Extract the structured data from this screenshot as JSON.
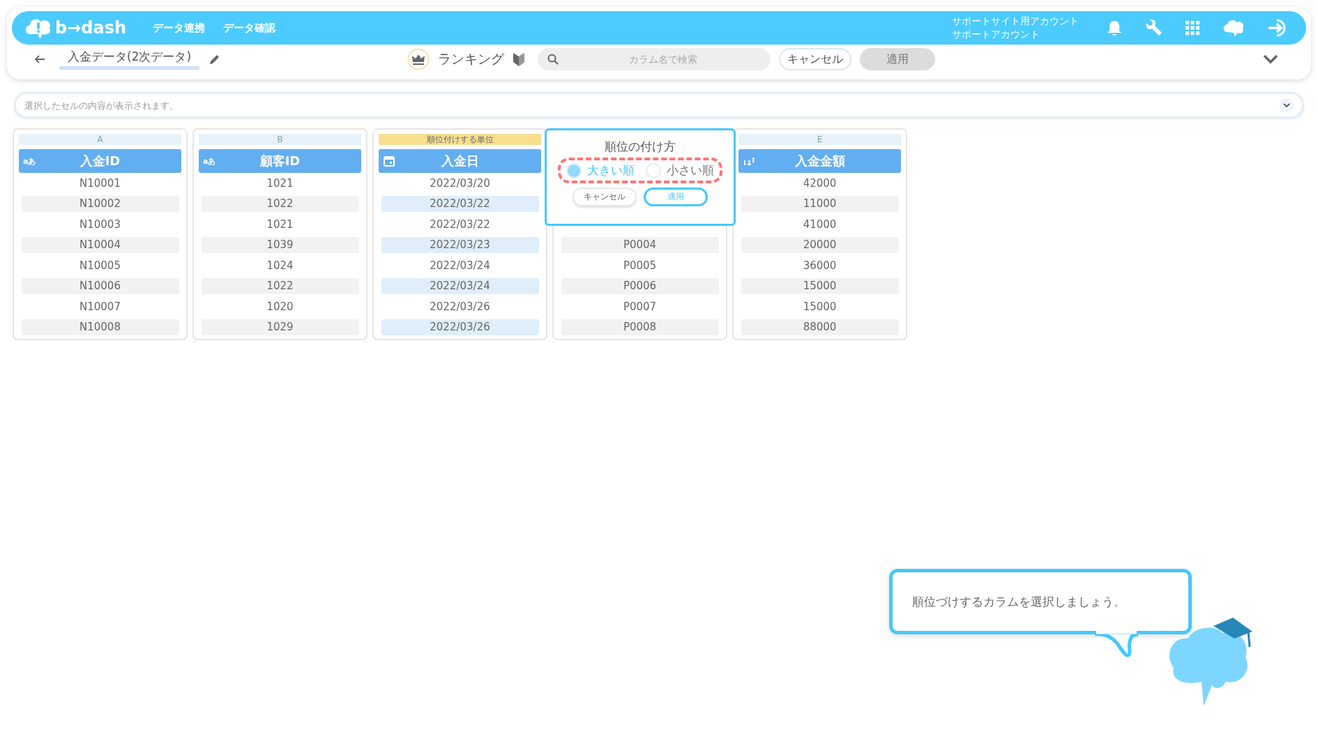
{
  "header": {
    "logo": "b→dash",
    "nav": [
      "データ連携",
      "データ確認"
    ],
    "account": [
      "サポートサイト用アカウント",
      "サポートアカウント"
    ]
  },
  "toolbar": {
    "title": "入金データ(2次データ)",
    "mode": "ランキング",
    "search": {
      "placeholder": "カラム名で検索"
    },
    "cancel": "キャンセル",
    "apply": {
      "label": "適用",
      "disabled": true
    }
  },
  "cell_bar": {
    "placeholder": "選択したセルの内容が表示されます。"
  },
  "columns": [
    {
      "band": "A",
      "unit": false,
      "kind": "text",
      "type_label": "aあ",
      "name": "入金ID",
      "cells": [
        "N10001",
        "N10002",
        "N10003",
        "N10004",
        "N10005",
        "N10006",
        "N10007",
        "N10008"
      ]
    },
    {
      "band": "B",
      "unit": false,
      "kind": "text",
      "type_label": "aあ",
      "name": "顧客ID",
      "cells": [
        "1021",
        "1022",
        "1021",
        "1039",
        "1024",
        "1022",
        "1020",
        "1029"
      ]
    },
    {
      "band": "順位付けする単位",
      "unit": true,
      "kind": "date",
      "name": "入金日",
      "cells": [
        "2022/03/20",
        "2022/03/22",
        "2022/03/22",
        "2022/03/23",
        "2022/03/24",
        "2022/03/24",
        "2022/03/26",
        "2022/03/26"
      ]
    },
    {
      "unit": false,
      "kind": "hidden",
      "cells": [
        "P0004",
        "P0005",
        "P0006",
        "P0007",
        "P0008"
      ]
    },
    {
      "band": "E",
      "unit": false,
      "kind": "number",
      "name": "入金金額",
      "cells": [
        "42000",
        "11000",
        "41000",
        "20000",
        "36000",
        "15000",
        "15000",
        "88000"
      ]
    }
  ],
  "popup": {
    "title": "順位の付け方",
    "options": [
      {
        "label": "大きい順",
        "selected": true
      },
      {
        "label": "小さい順",
        "selected": false
      }
    ],
    "buttons": [
      "キャンセル",
      "適用"
    ]
  },
  "hint": {
    "text": "順位づけするカラムを選択しましょう。"
  }
}
